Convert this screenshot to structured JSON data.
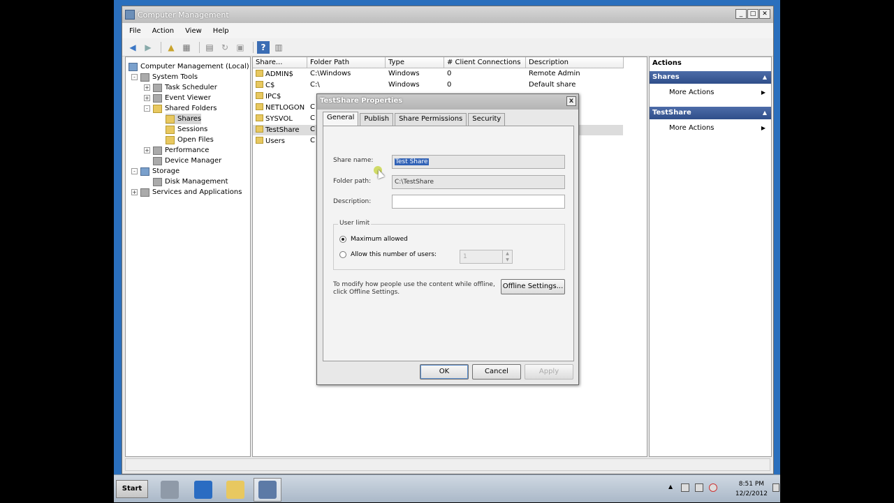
{
  "window": {
    "title": "Computer Management"
  },
  "menu": [
    "File",
    "Action",
    "View",
    "Help"
  ],
  "tree": [
    {
      "label": "Computer Management (Local)",
      "level": 0,
      "exp": ""
    },
    {
      "label": "System Tools",
      "level": 1,
      "exp": "-"
    },
    {
      "label": "Task Scheduler",
      "level": 2,
      "exp": "+"
    },
    {
      "label": "Event Viewer",
      "level": 2,
      "exp": "+"
    },
    {
      "label": "Shared Folders",
      "level": 2,
      "exp": "-"
    },
    {
      "label": "Shares",
      "level": 3,
      "exp": ""
    },
    {
      "label": "Sessions",
      "level": 3,
      "exp": ""
    },
    {
      "label": "Open Files",
      "level": 3,
      "exp": ""
    },
    {
      "label": "Performance",
      "level": 2,
      "exp": "+"
    },
    {
      "label": "Device Manager",
      "level": 2,
      "exp": ""
    },
    {
      "label": "Storage",
      "level": 1,
      "exp": "-"
    },
    {
      "label": "Disk Management",
      "level": 2,
      "exp": ""
    },
    {
      "label": "Services and Applications",
      "level": 1,
      "exp": "+"
    }
  ],
  "columns": [
    "Share...",
    "Folder Path",
    "Type",
    "# Client Connections",
    "Description"
  ],
  "rows": [
    {
      "name": "ADMIN$",
      "path": "C:\\Windows",
      "type": "Windows",
      "conn": "0",
      "desc": "Remote Admin"
    },
    {
      "name": "C$",
      "path": "C:\\",
      "type": "Windows",
      "conn": "0",
      "desc": "Default share"
    },
    {
      "name": "IPC$",
      "path": "",
      "type": "",
      "conn": "",
      "desc": ""
    },
    {
      "name": "NETLOGON",
      "path": "C",
      "type": "",
      "conn": "",
      "desc": "are"
    },
    {
      "name": "SYSVOL",
      "path": "C",
      "type": "",
      "conn": "",
      "desc": "are"
    },
    {
      "name": "TestShare",
      "path": "C",
      "type": "",
      "conn": "",
      "desc": ""
    },
    {
      "name": "Users",
      "path": "C",
      "type": "",
      "conn": "",
      "desc": ""
    }
  ],
  "actions": {
    "header": "Actions",
    "sections": [
      {
        "title": "Shares",
        "item": "More Actions"
      },
      {
        "title": "TestShare",
        "item": "More Actions"
      }
    ]
  },
  "dialog": {
    "title": "TestShare Properties",
    "close": "x",
    "tabs": [
      "General",
      "Publish",
      "Share Permissions",
      "Security"
    ],
    "share_name_label": "Share name:",
    "share_name_value": "Test Share",
    "folder_path_label": "Folder path:",
    "folder_path_value": "C:\\TestShare",
    "description_label": "Description:",
    "description_value": "",
    "user_limit_legend": "User limit",
    "radio_max": "Maximum allowed",
    "radio_allow": "Allow this number of users:",
    "spin_value": "1",
    "offline_text": "To modify how people use the content while offline, click Offline Settings.",
    "offline_button": "Offline Settings...",
    "ok": "OK",
    "cancel": "Cancel",
    "apply": "Apply"
  },
  "taskbar": {
    "start": "Start",
    "time": "8:51 PM",
    "date": "12/2/2012"
  }
}
